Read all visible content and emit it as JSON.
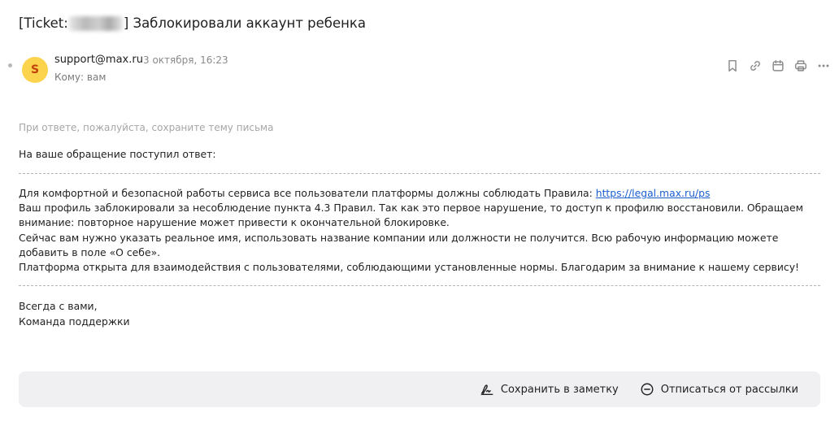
{
  "email": {
    "subject_prefix": "[Ticket:",
    "subject_suffix": "] Заблокировали аккаунт ребенка",
    "avatar_letter": "S",
    "sender": "support@max.ru",
    "date": "3 октября, 16:23",
    "to_label": "Кому:",
    "to_value": "вам"
  },
  "toolbar": {
    "icons": [
      "bookmark-icon",
      "link-icon",
      "calendar-icon",
      "print-icon",
      "more-icon"
    ]
  },
  "body": {
    "hint": "При ответе, пожалуйста, сохраните тему письма",
    "intro": "На ваше обращение поступил ответ:",
    "line1_text": "Для комфортной и безопасной работы сервиса все пользователи платформы должны соблюдать Правила: ",
    "line1_link": "https://legal.max.ru/ps",
    "line2": "Ваш профиль заблокировали за несоблюдение пункта 4.3 Правил. Так как это первое нарушение, то доступ к профилю восстановили. Обращаем внимание: повторное нарушение может привести к окончательной блокировке.",
    "line3": "Сейчас вам нужно указать реальное имя, использовать название компании или должности не получится. Всю рабочую информацию можете добавить в поле «О себе».",
    "line4": "Платформа открыта для взаимодействия с пользователями, соблюдающими установленные нормы. Благодарим за внимание к нашему сервису!",
    "sign1": "Всегда с вами,",
    "sign2": "Команда поддержки"
  },
  "footer": {
    "save_note": "Сохранить в заметку",
    "unsubscribe": "Отписаться от рассылки"
  }
}
